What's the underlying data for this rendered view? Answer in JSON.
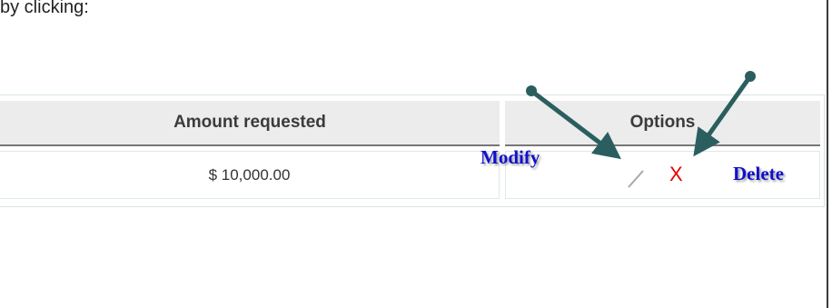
{
  "top_text": "by clicking:",
  "table": {
    "headers": {
      "amount": "Amount requested",
      "options": "Options"
    },
    "rows": [
      {
        "amount": "$ 10,000.00",
        "actions": {
          "edit_icon": "pencil-edit-icon",
          "delete_glyph": "X"
        }
      }
    ]
  },
  "annotations": {
    "modify_label": "Modify",
    "delete_label": "Delete"
  },
  "colors": {
    "header_bg": "#ececec",
    "annotation_text": "#1010cc",
    "arrow": "#2b5f5f",
    "delete_red": "#e60000"
  }
}
